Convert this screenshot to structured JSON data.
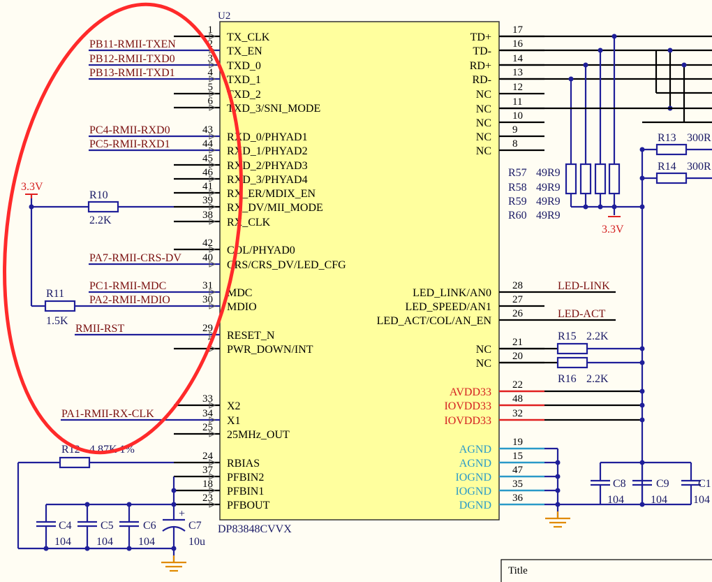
{
  "chip": {
    "designator": "U2",
    "part": "DP83848CVVX",
    "left_pins": [
      {
        "num": "1",
        "name": "TX_CLK",
        "net": ""
      },
      {
        "num": "2",
        "name": "TX_EN",
        "net": "PB11-RMII-TXEN"
      },
      {
        "num": "3",
        "name": "TXD_0",
        "net": "PB12-RMII-TXD0"
      },
      {
        "num": "4",
        "name": "TXD_1",
        "net": "PB13-RMII-TXD1"
      },
      {
        "num": "5",
        "name": "TXD_2",
        "net": ""
      },
      {
        "num": "6",
        "name": "TXD_3/SNI_MODE",
        "net": ""
      },
      {
        "num": "43",
        "name": "RXD_0/PHYAD1",
        "net": "PC4-RMII-RXD0"
      },
      {
        "num": "44",
        "name": "RXD_1/PHYAD2",
        "net": "PC5-RMII-RXD1"
      },
      {
        "num": "45",
        "name": "RXD_2/PHYAD3",
        "net": ""
      },
      {
        "num": "46",
        "name": "RXD_3/PHYAD4",
        "net": ""
      },
      {
        "num": "41",
        "name": "RX_ER/MDIX_EN",
        "net": ""
      },
      {
        "num": "39",
        "name": "RX_DV/MII_MODE",
        "net": ""
      },
      {
        "num": "38",
        "name": "RX_CLK",
        "net": ""
      },
      {
        "num": "42",
        "name": "COL/PHYAD0",
        "net": ""
      },
      {
        "num": "40",
        "name": "CRS/CRS_DV/LED_CFG",
        "net": "PA7-RMII-CRS-DV"
      },
      {
        "num": "31",
        "name": "MDC",
        "net": "PC1-RMII-MDC"
      },
      {
        "num": "30",
        "name": "MDIO",
        "net": "PA2-RMII-MDIO"
      },
      {
        "num": "29",
        "name": "RESET_N",
        "net": "RMII-RST"
      },
      {
        "num": "7",
        "name": "PWR_DOWN/INT",
        "net": ""
      },
      {
        "num": "33",
        "name": "X2",
        "net": ""
      },
      {
        "num": "34",
        "name": "X1",
        "net": "PA1-RMII-RX-CLK"
      },
      {
        "num": "25",
        "name": "25MHz_OUT",
        "net": ""
      },
      {
        "num": "24",
        "name": "RBIAS",
        "net": ""
      },
      {
        "num": "37",
        "name": "PFBIN2",
        "net": ""
      },
      {
        "num": "18",
        "name": "PFBIN1",
        "net": ""
      },
      {
        "num": "23",
        "name": "PFBOUT",
        "net": ""
      }
    ],
    "right_pins": [
      {
        "num": "17",
        "name": "TD+",
        "net": ""
      },
      {
        "num": "16",
        "name": "TD-",
        "net": ""
      },
      {
        "num": "14",
        "name": "RD+",
        "net": ""
      },
      {
        "num": "13",
        "name": "RD-",
        "net": ""
      },
      {
        "num": "12",
        "name": "NC",
        "net": ""
      },
      {
        "num": "11",
        "name": "NC",
        "net": ""
      },
      {
        "num": "10",
        "name": "NC",
        "net": ""
      },
      {
        "num": "9",
        "name": "NC",
        "net": ""
      },
      {
        "num": "8",
        "name": "NC",
        "net": ""
      },
      {
        "num": "28",
        "name": "LED_LINK/AN0",
        "net": "LED-LINK"
      },
      {
        "num": "27",
        "name": "LED_SPEED/AN1",
        "net": ""
      },
      {
        "num": "26",
        "name": "LED_ACT/COL/AN_EN",
        "net": "LED-ACT"
      },
      {
        "num": "21",
        "name": "NC",
        "net": ""
      },
      {
        "num": "20",
        "name": "NC",
        "net": ""
      },
      {
        "num": "22",
        "name": "AVDD33",
        "net": ""
      },
      {
        "num": "48",
        "name": "IOVDD33",
        "net": ""
      },
      {
        "num": "32",
        "name": "IOVDD33",
        "net": ""
      },
      {
        "num": "19",
        "name": "AGND",
        "net": ""
      },
      {
        "num": "15",
        "name": "AGND",
        "net": ""
      },
      {
        "num": "47",
        "name": "IOGND",
        "net": ""
      },
      {
        "num": "35",
        "name": "IOGND",
        "net": ""
      },
      {
        "num": "36",
        "name": "DGND",
        "net": ""
      }
    ]
  },
  "components": {
    "r10": {
      "des": "R10",
      "val": "2.2K"
    },
    "r11": {
      "des": "R11",
      "val": "1.5K"
    },
    "r12": {
      "des": "R12",
      "val": "4.87K  1%"
    },
    "r13": {
      "des": "R13",
      "val": "300R"
    },
    "r14": {
      "des": "R14",
      "val": "300R"
    },
    "r15": {
      "des": "R15",
      "val": "2.2K"
    },
    "r16": {
      "des": "R16",
      "val": "2.2K"
    },
    "r57": {
      "des": "R57",
      "val": "49R9"
    },
    "r58": {
      "des": "R58",
      "val": "49R9"
    },
    "r59": {
      "des": "R59",
      "val": "49R9"
    },
    "r60": {
      "des": "R60",
      "val": "49R9"
    },
    "c4": {
      "des": "C4",
      "val": "104"
    },
    "c5": {
      "des": "C5",
      "val": "104"
    },
    "c6": {
      "des": "C6",
      "val": "104"
    },
    "c7": {
      "des": "C7",
      "val": "10u",
      "polarity": "+"
    },
    "c8": {
      "des": "C8",
      "val": "104"
    },
    "c9": {
      "des": "C9",
      "val": "104"
    },
    "c10": {
      "des": "C1",
      "val": "104"
    }
  },
  "power": {
    "left": "3.3V",
    "right": "3.3V"
  },
  "title_block": {
    "label": "Title"
  },
  "colors": {
    "wire": "#1f1f99",
    "chip_fill": "#ffff9e",
    "annotation": "#ff2a2a",
    "power_pin": "#e02020",
    "ground_pin": "#2a9ac8",
    "ground_symbol": "#e08a00"
  }
}
